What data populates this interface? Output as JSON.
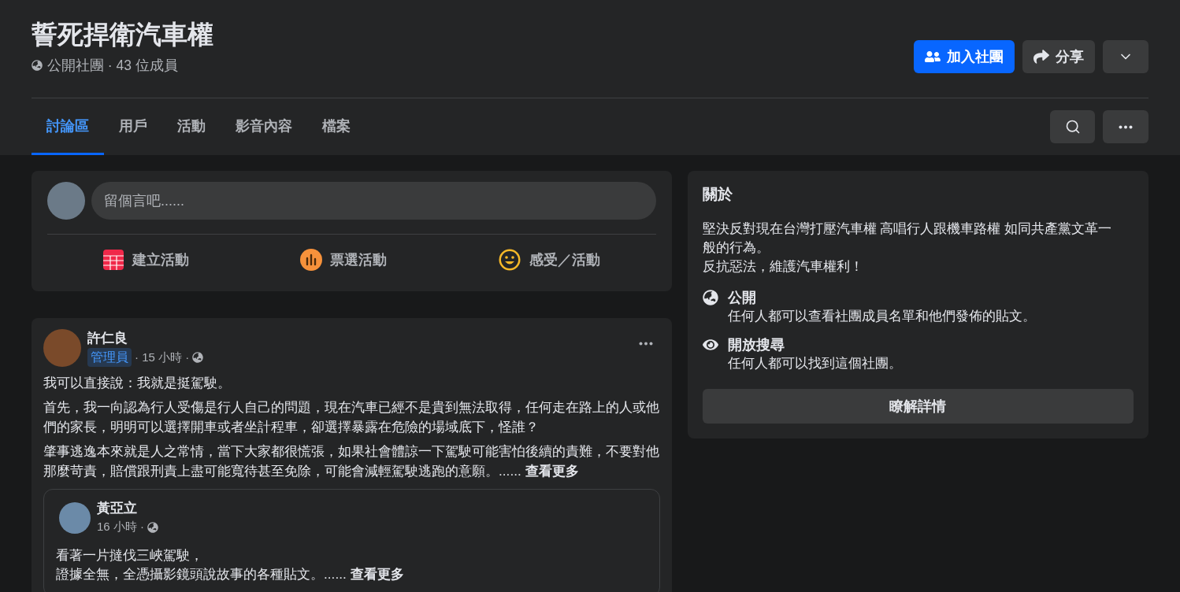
{
  "group": {
    "title": "誓死捍衛汽車權",
    "meta": "公開社團 · 43 位成員"
  },
  "header_buttons": {
    "join": "加入社團",
    "share": "分享"
  },
  "tabs": [
    {
      "label": "討論區",
      "selected": true
    },
    {
      "label": "用戶",
      "selected": false
    },
    {
      "label": "活動",
      "selected": false
    },
    {
      "label": "影音內容",
      "selected": false
    },
    {
      "label": "檔案",
      "selected": false
    }
  ],
  "composer": {
    "placeholder": "留個言吧......",
    "actions": [
      {
        "kind": "event",
        "label": "建立活動"
      },
      {
        "kind": "poll",
        "label": "票選活動"
      },
      {
        "kind": "feeling",
        "label": "感受／活動"
      }
    ]
  },
  "post": {
    "author": "許仁良",
    "badge": "管理員",
    "time": "· 15 小時 ·",
    "paragraphs": [
      "我可以直接說：我就是挺駕駛。",
      "首先，我一向認為行人受傷是行人自己的問題，現在汽車已經不是貴到無法取得，任何走在路上的人或他們的家長，明明可以選擇開車或者坐計程車，卻選擇暴露在危險的場域底下，怪誰？",
      "肇事逃逸本來就是人之常情，當下大家都很慌張，如果社會體諒一下駕駛可能害怕後續的責難，不要對他那麼苛責，賠償跟刑責上盡可能寬待甚至免除，可能會減輕駕駛逃跑的意願。......"
    ],
    "see_more": "查看更多",
    "shared": {
      "author": "黃亞立",
      "time": "16 小時 ·",
      "lines": [
        "看著一片撻伐三峽駕駛，",
        "證據全無，全憑攝影鏡頭說故事的各種貼文。......"
      ],
      "see_more": "查看更多"
    }
  },
  "about": {
    "title": "關於",
    "description": [
      "堅決反對現在台灣打壓汽車權 高唱行人跟機車路權 如同共產黨文革一般的行為。",
      "反抗惡法，維護汽車權利！"
    ],
    "items": [
      {
        "kind": "public",
        "title": "公開",
        "text": "任何人都可以查看社團成員名單和他們發佈的貼文。"
      },
      {
        "kind": "visible",
        "title": "開放搜尋",
        "text": "任何人都可以找到這個社團。"
      }
    ],
    "button": "瞭解詳情"
  }
}
